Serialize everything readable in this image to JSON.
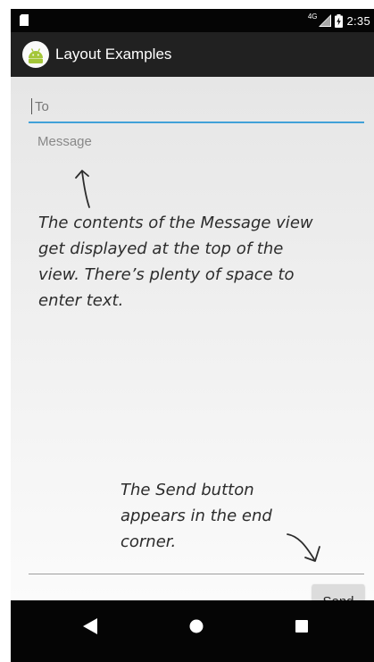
{
  "status_bar": {
    "network": "4G",
    "time": "2:35"
  },
  "app_bar": {
    "title": "Layout Examples"
  },
  "form": {
    "to_placeholder": "To",
    "message_placeholder": "Message",
    "send_label": "Send"
  },
  "annotations": {
    "message_note": "The contents of the Message view get displayed at the top of the view. There’s plenty of space to enter text.",
    "send_note": "The Send button appears in the end corner."
  },
  "icons": {
    "sim": "sd-card-icon",
    "signal": "signal-icon",
    "battery": "battery-charging-icon",
    "app": "android-icon",
    "back": "back-triangle-icon",
    "home": "home-circle-icon",
    "recents": "recents-square-icon"
  },
  "colors": {
    "app_bar": "#212121",
    "status_bar": "#050505",
    "field_focus_underline": "#41a1d8",
    "send_button": "#dcdcdc",
    "android_green": "#a4c639"
  }
}
